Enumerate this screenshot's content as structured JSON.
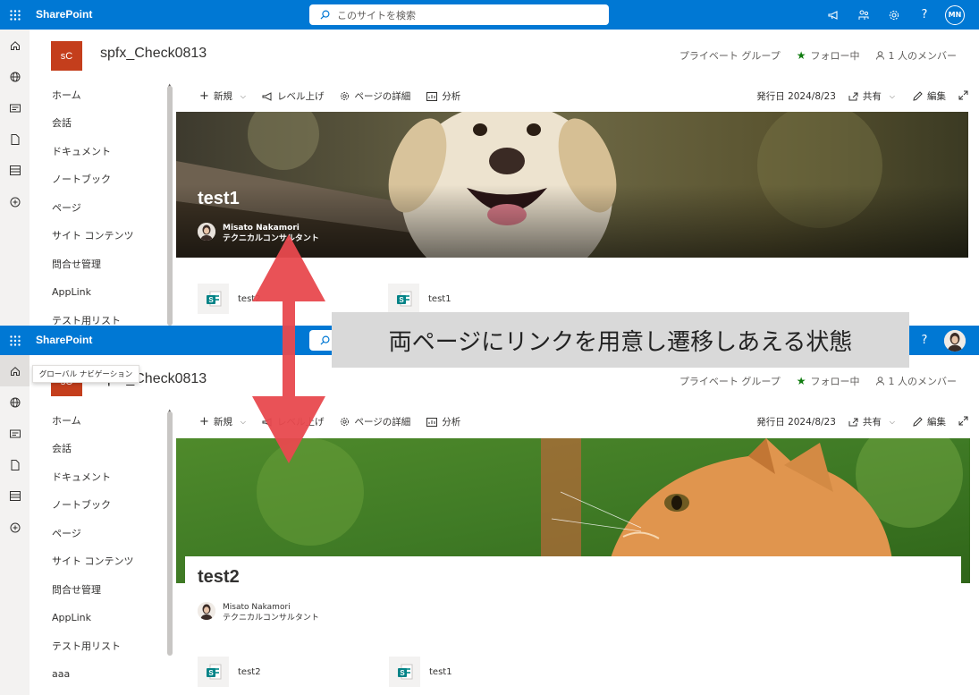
{
  "suitebar": {
    "brand": "SharePoint",
    "search_placeholder": "このサイトを検索",
    "me_initials": "MN"
  },
  "site": {
    "logo_text": "sC",
    "name": "spfx_Check0813",
    "privacy": "プライベート グループ",
    "follow": "フォロー中",
    "members": "1 人のメンバー"
  },
  "nav": [
    "ホーム",
    "会話",
    "ドキュメント",
    "ノートブック",
    "ページ",
    "サイト コンテンツ",
    "問合せ管理",
    "AppLink",
    "テスト用リスト",
    "aaa"
  ],
  "commands": {
    "new": "新規",
    "level_up": "レベル上げ",
    "page_details": "ページの詳細",
    "analytics": "分析",
    "published": "発行日 2024/8/23",
    "share": "共有",
    "edit": "編集"
  },
  "page1": {
    "title": "test1",
    "author_name": "Misato Nakamori",
    "author_title": "テクニカルコンサルタント",
    "links": [
      "test2",
      "test1"
    ]
  },
  "page2": {
    "title": "test2",
    "author_name": "Misato Nakamori",
    "author_title": "テクニカルコンサルタント",
    "links": [
      "test2",
      "test1"
    ]
  },
  "tooltip": "グローバル ナビゲーション",
  "callout": "両ページにリンクを用意し遷移しあえる状態",
  "colors": {
    "suitebar": "#0078d4",
    "site_logo": "#c43e1c",
    "follow_star": "#107c10",
    "arrow": "#e8494e",
    "callout_bg": "#d9d9d9"
  }
}
